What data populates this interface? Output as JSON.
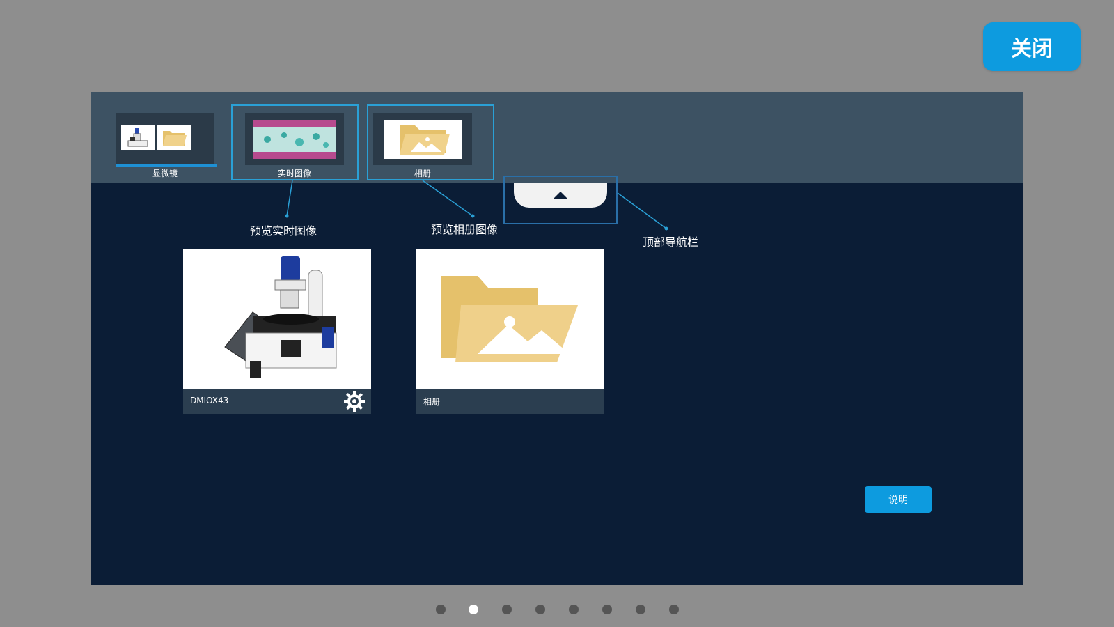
{
  "close_button": {
    "label": "关闭"
  },
  "top_nav": {
    "tiles": [
      {
        "label": "显微镜",
        "icon": "microscope-and-folder-thumbnail"
      },
      {
        "label": "实时图像",
        "icon": "tissue-sample-thumbnail"
      },
      {
        "label": "相册",
        "icon": "folder-image-thumbnail"
      }
    ],
    "collapse_icon": "triangle-up-icon"
  },
  "callouts": {
    "live_preview": "预览实时图像",
    "album_preview": "预览相册图像",
    "top_nav": "顶部导航栏"
  },
  "cards": [
    {
      "label": "DMIOX43",
      "icon": "microscope-image",
      "settings_icon": "gear-icon"
    },
    {
      "label": "相册",
      "icon": "folder-image-icon"
    }
  ],
  "help_button": {
    "label": "说明"
  },
  "pagination": {
    "total": 8,
    "active_index": 1
  },
  "colors": {
    "background": "#8e8e8e",
    "panel": "#0b1d36",
    "nav_bar": "#3d5263",
    "accent": "#0d9bdf",
    "folder": "#e5c16b"
  }
}
